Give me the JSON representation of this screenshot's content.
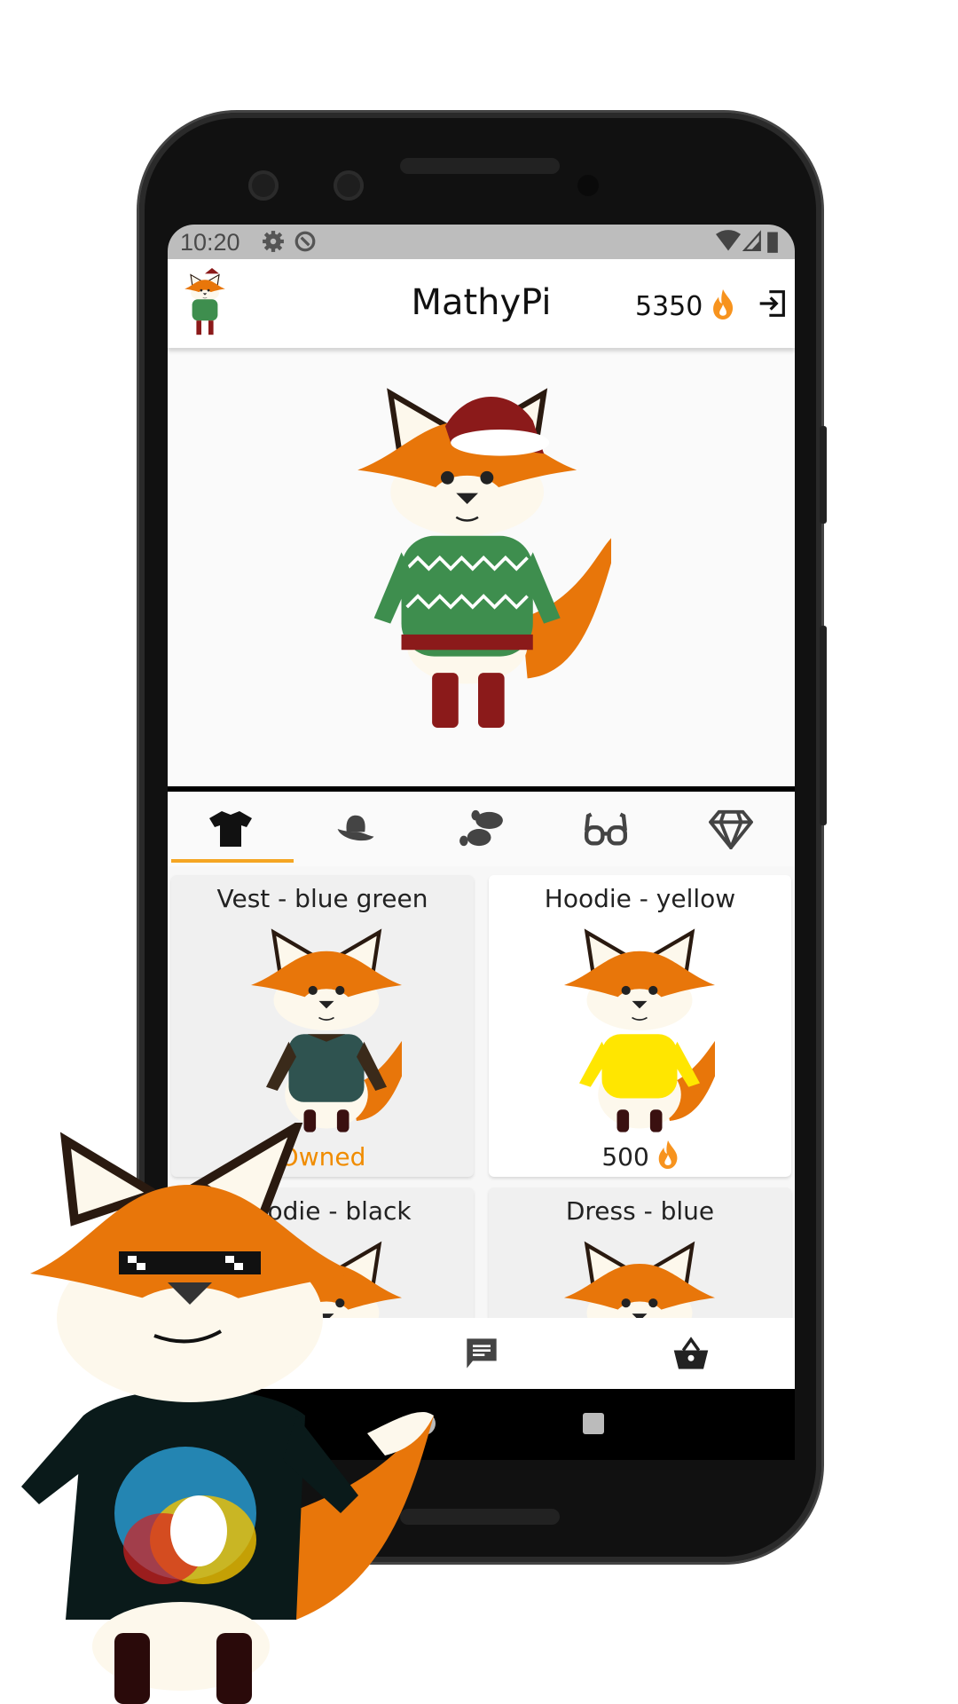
{
  "status_bar": {
    "time": "10:20",
    "icons": [
      "gear-icon",
      "sync-icon",
      "wifi-icon",
      "signal-icon",
      "battery-icon"
    ]
  },
  "app_bar": {
    "title": "MathyPi",
    "coins": "5350",
    "coin_icon": "flame-icon",
    "logout_icon": "logout-icon"
  },
  "tabs": [
    {
      "icon": "shirt-icon",
      "selected": true
    },
    {
      "icon": "hat-icon",
      "selected": false
    },
    {
      "icon": "footprints-icon",
      "selected": false
    },
    {
      "icon": "glasses-icon",
      "selected": false
    },
    {
      "icon": "diamond-icon",
      "selected": false
    }
  ],
  "items": [
    {
      "name": "Vest - blue green",
      "status": "Owned"
    },
    {
      "name": "Hoodie - yellow",
      "price": "500"
    },
    {
      "name": "Hoodie - black"
    },
    {
      "name": "Dress - blue"
    }
  ],
  "bottom_nav": [
    "home-icon",
    "chat-icon",
    "basket-icon"
  ],
  "colors": {
    "accent": "#f5a623",
    "flame": "#f7931e",
    "owned": "#f08c00",
    "fox_orange": "#e8760a"
  }
}
